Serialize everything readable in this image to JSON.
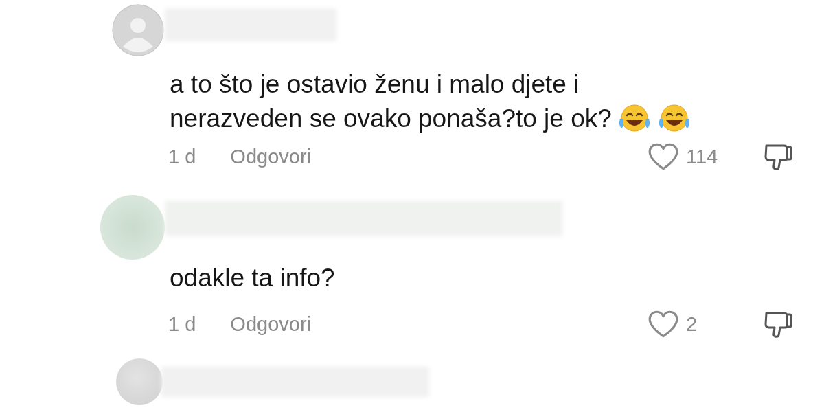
{
  "comments": [
    {
      "avatar": {
        "kind": "default"
      },
      "lines": [
        "a to što je ostavio ženu i malo djete i",
        "nerazveden se ovako ponaša?to je ok?"
      ],
      "emojis": [
        {
          "kind": "laughing"
        },
        {
          "kind": "laughing"
        }
      ],
      "time": "1 d",
      "reply": "Odgovori",
      "likes": "114"
    },
    {
      "avatar": {
        "kind": "large"
      },
      "lines": [
        "odakle ta info?"
      ],
      "time": "1 d",
      "reply": "Odgovori",
      "likes": "2"
    },
    {
      "avatar": {
        "kind": "small"
      }
    }
  ]
}
